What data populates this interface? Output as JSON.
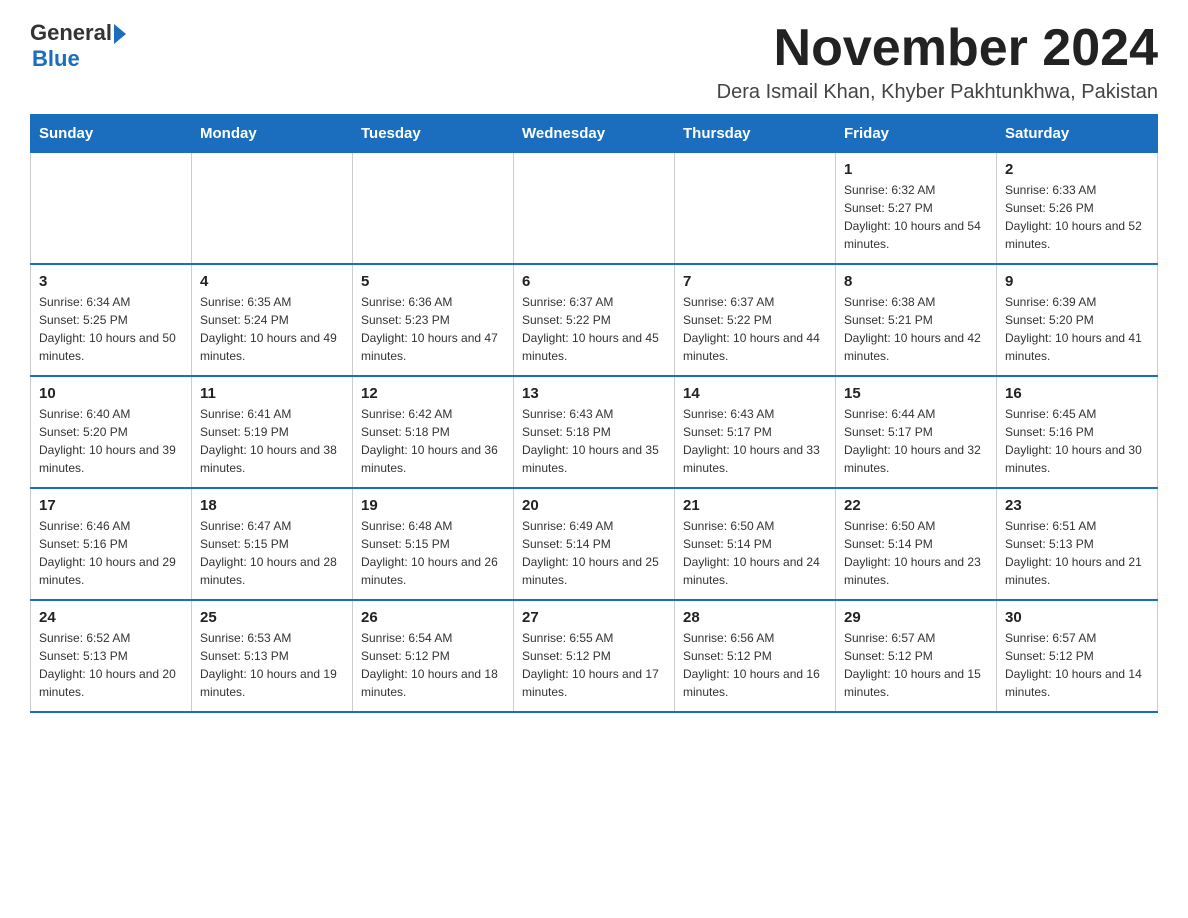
{
  "header": {
    "logo_general": "General",
    "logo_blue": "Blue",
    "month_year": "November 2024",
    "location": "Dera Ismail Khan, Khyber Pakhtunkhwa, Pakistan"
  },
  "weekdays": [
    "Sunday",
    "Monday",
    "Tuesday",
    "Wednesday",
    "Thursday",
    "Friday",
    "Saturday"
  ],
  "weeks": [
    [
      {
        "day": "",
        "info": ""
      },
      {
        "day": "",
        "info": ""
      },
      {
        "day": "",
        "info": ""
      },
      {
        "day": "",
        "info": ""
      },
      {
        "day": "",
        "info": ""
      },
      {
        "day": "1",
        "info": "Sunrise: 6:32 AM\nSunset: 5:27 PM\nDaylight: 10 hours and 54 minutes."
      },
      {
        "day": "2",
        "info": "Sunrise: 6:33 AM\nSunset: 5:26 PM\nDaylight: 10 hours and 52 minutes."
      }
    ],
    [
      {
        "day": "3",
        "info": "Sunrise: 6:34 AM\nSunset: 5:25 PM\nDaylight: 10 hours and 50 minutes."
      },
      {
        "day": "4",
        "info": "Sunrise: 6:35 AM\nSunset: 5:24 PM\nDaylight: 10 hours and 49 minutes."
      },
      {
        "day": "5",
        "info": "Sunrise: 6:36 AM\nSunset: 5:23 PM\nDaylight: 10 hours and 47 minutes."
      },
      {
        "day": "6",
        "info": "Sunrise: 6:37 AM\nSunset: 5:22 PM\nDaylight: 10 hours and 45 minutes."
      },
      {
        "day": "7",
        "info": "Sunrise: 6:37 AM\nSunset: 5:22 PM\nDaylight: 10 hours and 44 minutes."
      },
      {
        "day": "8",
        "info": "Sunrise: 6:38 AM\nSunset: 5:21 PM\nDaylight: 10 hours and 42 minutes."
      },
      {
        "day": "9",
        "info": "Sunrise: 6:39 AM\nSunset: 5:20 PM\nDaylight: 10 hours and 41 minutes."
      }
    ],
    [
      {
        "day": "10",
        "info": "Sunrise: 6:40 AM\nSunset: 5:20 PM\nDaylight: 10 hours and 39 minutes."
      },
      {
        "day": "11",
        "info": "Sunrise: 6:41 AM\nSunset: 5:19 PM\nDaylight: 10 hours and 38 minutes."
      },
      {
        "day": "12",
        "info": "Sunrise: 6:42 AM\nSunset: 5:18 PM\nDaylight: 10 hours and 36 minutes."
      },
      {
        "day": "13",
        "info": "Sunrise: 6:43 AM\nSunset: 5:18 PM\nDaylight: 10 hours and 35 minutes."
      },
      {
        "day": "14",
        "info": "Sunrise: 6:43 AM\nSunset: 5:17 PM\nDaylight: 10 hours and 33 minutes."
      },
      {
        "day": "15",
        "info": "Sunrise: 6:44 AM\nSunset: 5:17 PM\nDaylight: 10 hours and 32 minutes."
      },
      {
        "day": "16",
        "info": "Sunrise: 6:45 AM\nSunset: 5:16 PM\nDaylight: 10 hours and 30 minutes."
      }
    ],
    [
      {
        "day": "17",
        "info": "Sunrise: 6:46 AM\nSunset: 5:16 PM\nDaylight: 10 hours and 29 minutes."
      },
      {
        "day": "18",
        "info": "Sunrise: 6:47 AM\nSunset: 5:15 PM\nDaylight: 10 hours and 28 minutes."
      },
      {
        "day": "19",
        "info": "Sunrise: 6:48 AM\nSunset: 5:15 PM\nDaylight: 10 hours and 26 minutes."
      },
      {
        "day": "20",
        "info": "Sunrise: 6:49 AM\nSunset: 5:14 PM\nDaylight: 10 hours and 25 minutes."
      },
      {
        "day": "21",
        "info": "Sunrise: 6:50 AM\nSunset: 5:14 PM\nDaylight: 10 hours and 24 minutes."
      },
      {
        "day": "22",
        "info": "Sunrise: 6:50 AM\nSunset: 5:14 PM\nDaylight: 10 hours and 23 minutes."
      },
      {
        "day": "23",
        "info": "Sunrise: 6:51 AM\nSunset: 5:13 PM\nDaylight: 10 hours and 21 minutes."
      }
    ],
    [
      {
        "day": "24",
        "info": "Sunrise: 6:52 AM\nSunset: 5:13 PM\nDaylight: 10 hours and 20 minutes."
      },
      {
        "day": "25",
        "info": "Sunrise: 6:53 AM\nSunset: 5:13 PM\nDaylight: 10 hours and 19 minutes."
      },
      {
        "day": "26",
        "info": "Sunrise: 6:54 AM\nSunset: 5:12 PM\nDaylight: 10 hours and 18 minutes."
      },
      {
        "day": "27",
        "info": "Sunrise: 6:55 AM\nSunset: 5:12 PM\nDaylight: 10 hours and 17 minutes."
      },
      {
        "day": "28",
        "info": "Sunrise: 6:56 AM\nSunset: 5:12 PM\nDaylight: 10 hours and 16 minutes."
      },
      {
        "day": "29",
        "info": "Sunrise: 6:57 AM\nSunset: 5:12 PM\nDaylight: 10 hours and 15 minutes."
      },
      {
        "day": "30",
        "info": "Sunrise: 6:57 AM\nSunset: 5:12 PM\nDaylight: 10 hours and 14 minutes."
      }
    ]
  ]
}
